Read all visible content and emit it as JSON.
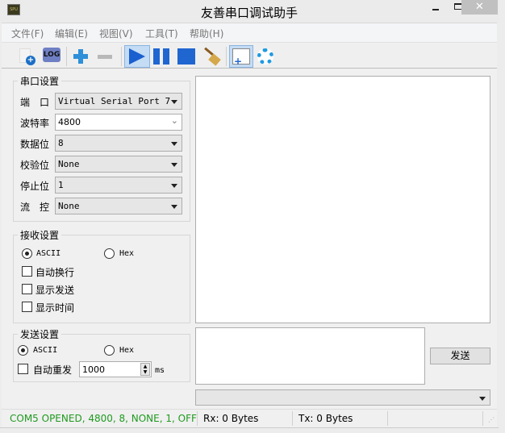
{
  "window": {
    "title": "友善串口调试助手",
    "icon_text": "SPU"
  },
  "menu": [
    "文件(F)",
    "编辑(E)",
    "视图(V)",
    "工具(T)",
    "帮助(H)"
  ],
  "toolbar": [
    "new-icon",
    "log-icon",
    "add-icon",
    "remove-icon",
    "play-icon",
    "pause-icon",
    "stop-icon",
    "clear-broom-icon",
    "layout-icon",
    "settings-gear-icon"
  ],
  "serial": {
    "title": "串口设置",
    "port_label": "端　口",
    "port": "Virtual Serial Port 7",
    "baud_label": "波特率",
    "baud": "4800",
    "data_label": "数据位",
    "data": "8",
    "parity_label": "校验位",
    "parity": "None",
    "stop_label": "停止位",
    "stop": "1",
    "flow_label": "流　控",
    "flow": "None"
  },
  "receive": {
    "title": "接收设置",
    "ascii": "ASCII",
    "hex": "Hex",
    "selected": "ASCII",
    "auto_wrap": "自动换行",
    "show_send": "显示发送",
    "show_time": "显示时间"
  },
  "send": {
    "title": "发送设置",
    "ascii": "ASCII",
    "hex": "Hex",
    "selected": "ASCII",
    "auto_resend": "自动重发",
    "interval": "1000",
    "unit": "ms",
    "button": "发送"
  },
  "status": {
    "connection": "COM5 OPENED, 4800, 8, NONE, 1, OFF",
    "rx": "Rx: 0 Bytes",
    "tx": "Tx: 0 Bytes",
    "connection_color": "#1f9a1f"
  }
}
